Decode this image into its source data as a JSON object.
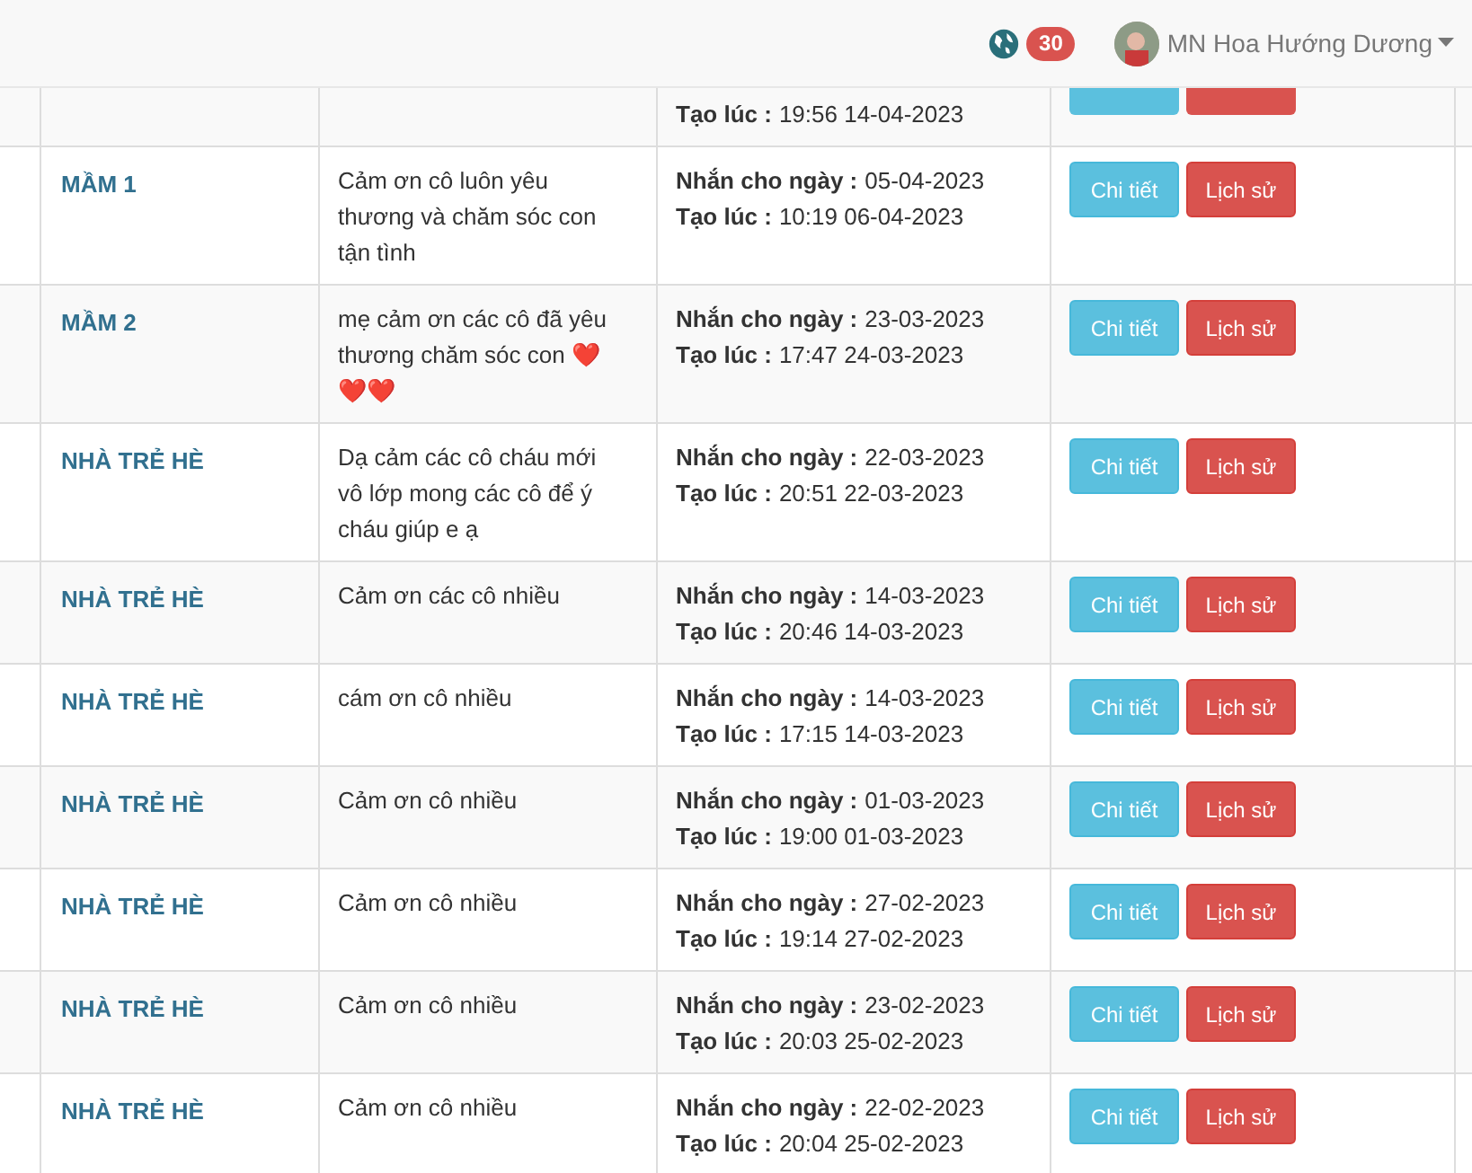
{
  "header": {
    "notification_count": "30",
    "user_name": "MN Hoa Hướng Dương"
  },
  "partial_row": {
    "created_label": "Tạo lúc :",
    "created_value": "19:56 14-04-2023"
  },
  "rows": [
    {
      "class_name": "MẦM 1",
      "message": "Cảm ơn cô luôn yêu thương và chăm sóc con tận tình",
      "date_label": "Nhắn cho ngày :",
      "date_value": "05-04-2023",
      "created_label": "Tạo lúc :",
      "created_value": "10:19 06-04-2023",
      "buttons": [
        "Chi tiết",
        "Lịch sử"
      ]
    },
    {
      "class_name": "MẦM 2",
      "message": "mẹ cảm ơn các cô đã yêu thương chăm sóc con ❤️❤️❤️",
      "date_label": "Nhắn cho ngày :",
      "date_value": "23-03-2023",
      "created_label": "Tạo lúc :",
      "created_value": "17:47 24-03-2023",
      "buttons": [
        "Chi tiết",
        "Lịch sử"
      ]
    },
    {
      "class_name": "NHÀ TRẺ HÈ",
      "message": "Dạ cảm các cô cháu mới vô lớp mong các cô để ý cháu giúp e ạ",
      "date_label": "Nhắn cho ngày :",
      "date_value": "22-03-2023",
      "created_label": "Tạo lúc :",
      "created_value": "20:51 22-03-2023",
      "buttons": [
        "Chi tiết",
        "Lịch sử"
      ]
    },
    {
      "class_name": "NHÀ TRẺ HÈ",
      "message": "Cảm ơn các cô nhiều",
      "date_label": "Nhắn cho ngày :",
      "date_value": "14-03-2023",
      "created_label": "Tạo lúc :",
      "created_value": "20:46 14-03-2023",
      "buttons": [
        "Chi tiết",
        "Lịch sử"
      ]
    },
    {
      "class_name": "NHÀ TRẺ HÈ",
      "message": "cám ơn cô nhiều",
      "date_label": "Nhắn cho ngày :",
      "date_value": "14-03-2023",
      "created_label": "Tạo lúc :",
      "created_value": "17:15 14-03-2023",
      "buttons": [
        "Chi tiết",
        "Lịch sử"
      ]
    },
    {
      "class_name": "NHÀ TRẺ HÈ",
      "message": "Cảm ơn cô nhiều",
      "date_label": "Nhắn cho ngày :",
      "date_value": "01-03-2023",
      "created_label": "Tạo lúc :",
      "created_value": "19:00 01-03-2023",
      "buttons": [
        "Chi tiết",
        "Lịch sử"
      ]
    },
    {
      "class_name": "NHÀ TRẺ HÈ",
      "message": "Cảm ơn cô nhiều",
      "date_label": "Nhắn cho ngày :",
      "date_value": "27-02-2023",
      "created_label": "Tạo lúc :",
      "created_value": "19:14 27-02-2023",
      "buttons": [
        "Chi tiết",
        "Lịch sử"
      ]
    },
    {
      "class_name": "NHÀ TRẺ HÈ",
      "message": "Cảm ơn cô nhiều",
      "date_label": "Nhắn cho ngày :",
      "date_value": "23-02-2023",
      "created_label": "Tạo lúc :",
      "created_value": "20:03 25-02-2023",
      "buttons": [
        "Chi tiết",
        "Lịch sử"
      ]
    },
    {
      "class_name": "NHÀ TRẺ HÈ",
      "message": "Cảm ơn cô nhiều",
      "date_label": "Nhắn cho ngày :",
      "date_value": "22-02-2023",
      "created_label": "Tạo lúc :",
      "created_value": "20:04 25-02-2023",
      "buttons": [
        "Chi tiết",
        "Lịch sử"
      ]
    }
  ]
}
